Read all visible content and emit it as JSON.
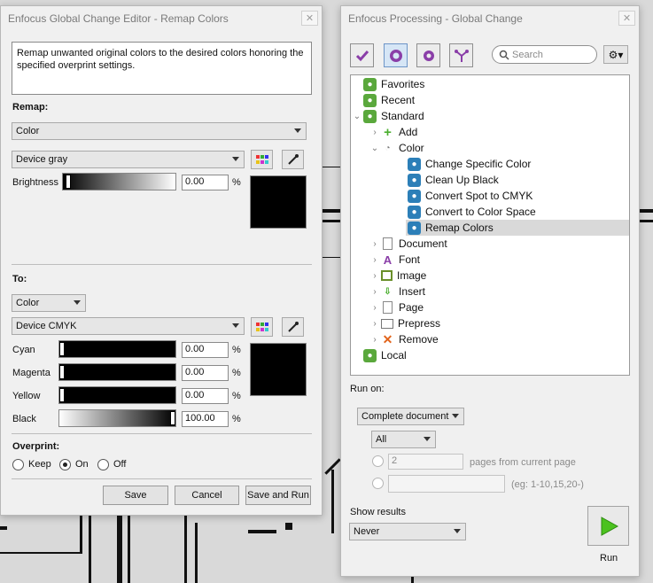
{
  "editor": {
    "title": "Enfocus Global Change Editor - Remap Colors",
    "description": "Remap unwanted original colors to the desired colors honoring the specified overprint settings.",
    "remap_label": "Remap:",
    "remap_mode": "Color",
    "remap_space": "Device gray",
    "brightness_label": "Brightness",
    "brightness_value": "0.00",
    "percent": "%",
    "to_label": "To:",
    "to_mode": "Color",
    "to_space": "Device CMYK",
    "channels": [
      {
        "label": "Cyan",
        "value": "0.00",
        "level": 0
      },
      {
        "label": "Magenta",
        "value": "0.00",
        "level": 0
      },
      {
        "label": "Yellow",
        "value": "0.00",
        "level": 0
      },
      {
        "label": "Black",
        "value": "100.00",
        "level": 100
      }
    ],
    "overprint_label": "Overprint:",
    "overprint_options": [
      "Keep",
      "On",
      "Off"
    ],
    "overprint_selected": "On",
    "buttons": {
      "save": "Save",
      "cancel": "Cancel",
      "save_run": "Save and Run"
    }
  },
  "processing": {
    "title": "Enfocus Processing - Global Change",
    "search_placeholder": "Search",
    "tree": {
      "favorites": "Favorites",
      "recent": "Recent",
      "standard": "Standard",
      "add": "Add",
      "color": "Color",
      "color_items": [
        "Change Specific Color",
        "Clean Up Black",
        "Convert Spot to CMYK",
        "Convert to Color Space",
        "Remap Colors"
      ],
      "others": [
        "Document",
        "Font",
        "Image",
        "Insert",
        "Page",
        "Prepress",
        "Remove"
      ],
      "local": "Local"
    },
    "run_on_label": "Run on:",
    "run_on_value": "Complete document",
    "pages_value": "All",
    "pages_count": "2",
    "pages_suffix": "pages from current page",
    "range_hint": "(eg: 1-10,15,20-)",
    "show_results_label": "Show results",
    "show_results_value": "Never",
    "run_label": "Run"
  }
}
